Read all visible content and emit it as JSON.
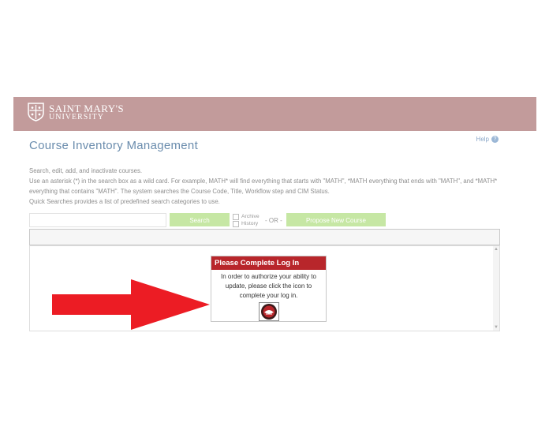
{
  "brand": {
    "line1": "SAINT MARY'S",
    "line2": "UNIVERSITY",
    "bar_color": "#c29b9b"
  },
  "help": {
    "label": "Help",
    "icon": "question-icon"
  },
  "page": {
    "title": "Course Inventory Management",
    "description": [
      "Search, edit, add, and inactivate courses.",
      "Use an asterisk (*) in the search box as a wild card. For example, MATH* will find everything that starts with \"MATH\", *MATH everything that ends with \"MATH\", and *MATH* everything that contains \"MATH\". The system searches the Course Code, Title, Workflow step and CIM Status.",
      "Quick Searches provides a list of predefined search categories to use."
    ]
  },
  "search": {
    "value": "",
    "placeholder": "",
    "button_label": "Search",
    "archive_label": "Archive",
    "history_label": "History",
    "or_label": "- OR -",
    "propose_label": "Propose New Course",
    "button_color": "#c6e7a4"
  },
  "login_popup": {
    "title": "Please Complete Log In",
    "message": "In order to authorize your ability to update, please click the icon to complete your log in.",
    "icon": "login-logo-icon",
    "header_color": "#b8262b"
  },
  "annotation": {
    "icon": "red-arrow",
    "color": "#ec1c24"
  }
}
